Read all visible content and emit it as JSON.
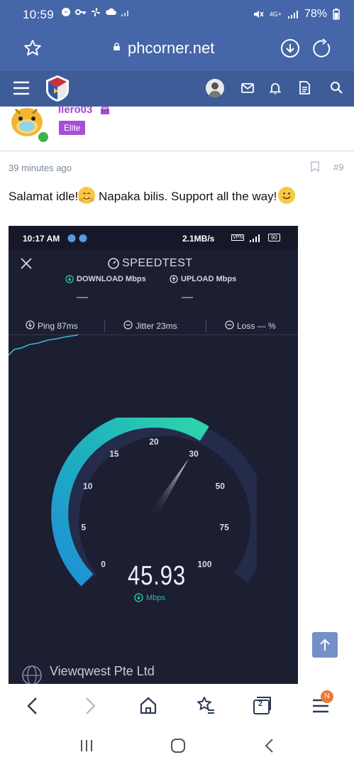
{
  "status_bar": {
    "time": "10:59",
    "battery": "78%",
    "network": "4G+"
  },
  "browser": {
    "url": "phcorner.net"
  },
  "post": {
    "username": "llero03",
    "badge": "Elite",
    "time_ago": "39 minutes ago",
    "post_number": "#9",
    "text_part1": "Salamat idle!",
    "text_part2": " Napaka bilis. Support all the way!"
  },
  "screenshot": {
    "status_time": "10:17 AM",
    "status_speed": "2.1MB/s",
    "status_vpn": "VPN",
    "status_battery": "90",
    "title": "SPEEDTEST",
    "download_label": "DOWNLOAD Mbps",
    "upload_label": "UPLOAD Mbps",
    "download_value": "—",
    "upload_value": "—",
    "ping": "Ping 87ms",
    "jitter": "Jitter 23ms",
    "loss": "Loss — %",
    "gauge_value": "45.93",
    "gauge_unit": "Mbps",
    "gauge_reading_fraction": 0.62,
    "ticks": [
      "0",
      "5",
      "10",
      "15",
      "20",
      "30",
      "50",
      "75",
      "100"
    ],
    "isp": "Viewqwest Pte Ltd"
  },
  "toolbar": {
    "tab_count": "2",
    "menu_badge": "N"
  },
  "colors": {
    "topbar": "#4566a8",
    "forumnav": "#3e5c97",
    "username": "#a34ad0",
    "badge": "#a64fd6",
    "gauge_accent": "#2fc9a8"
  }
}
